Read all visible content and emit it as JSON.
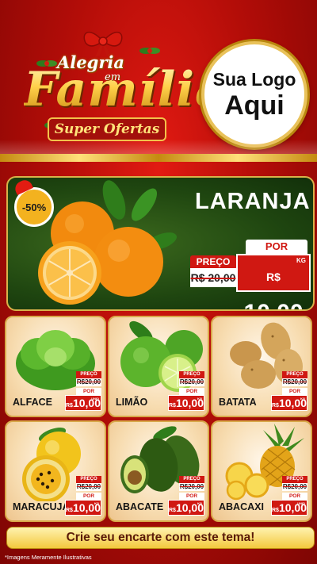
{
  "header": {
    "title_top": "Alegria",
    "title_em": "em",
    "title_main": "Família",
    "title_sub": "Super Ofertas",
    "logo_line1": "Sua Logo",
    "logo_line2": "Aqui"
  },
  "featured": {
    "discount_badge": "-50%",
    "name": "LARANJA",
    "por_label": "POR",
    "preco_label": "PREÇO",
    "old_price": "R$ 20,00",
    "currency": "R$",
    "new_price": "10,00",
    "unit": "KG"
  },
  "products": [
    {
      "name": "ALFACE",
      "preco_label": "PREÇO",
      "old_price": "R$20,00",
      "por_label": "POR",
      "currency": "R$",
      "new_price": "10,00",
      "unit": "UNID"
    },
    {
      "name": "LIMÃO",
      "preco_label": "PREÇO",
      "old_price": "R$20,00",
      "por_label": "POR",
      "currency": "R$",
      "new_price": "10,00",
      "unit": "KG"
    },
    {
      "name": "BATATA",
      "preco_label": "PREÇO",
      "old_price": "R$20,00",
      "por_label": "POR",
      "currency": "R$",
      "new_price": "10,00",
      "unit": "KG"
    },
    {
      "name": "MARACUJÁ",
      "preco_label": "PREÇO",
      "old_price": "R$20,00",
      "por_label": "POR",
      "currency": "R$",
      "new_price": "10,00",
      "unit": "KG"
    },
    {
      "name": "ABACATE",
      "preco_label": "PREÇO",
      "old_price": "R$20,00",
      "por_label": "POR",
      "currency": "R$",
      "new_price": "10,00",
      "unit": "KG"
    },
    {
      "name": "ABACAXI",
      "preco_label": "PREÇO",
      "old_price": "R$20,00",
      "por_label": "POR",
      "currency": "R$",
      "new_price": "10,00",
      "unit": "UNID"
    }
  ],
  "footer": {
    "cta": "Crie seu encarte com este tema!",
    "disclaimer": "*Imagens Meramente Ilustrativas"
  },
  "colors": {
    "background_red": "#b30d08",
    "gold": "#f2c24a",
    "price_red": "#d01812",
    "featured_green": "#1f4610",
    "card_cream": "#f7dcb0"
  },
  "icons": [
    "ribbon-bow-icon",
    "holly-icon",
    "santa-hat-icon"
  ]
}
